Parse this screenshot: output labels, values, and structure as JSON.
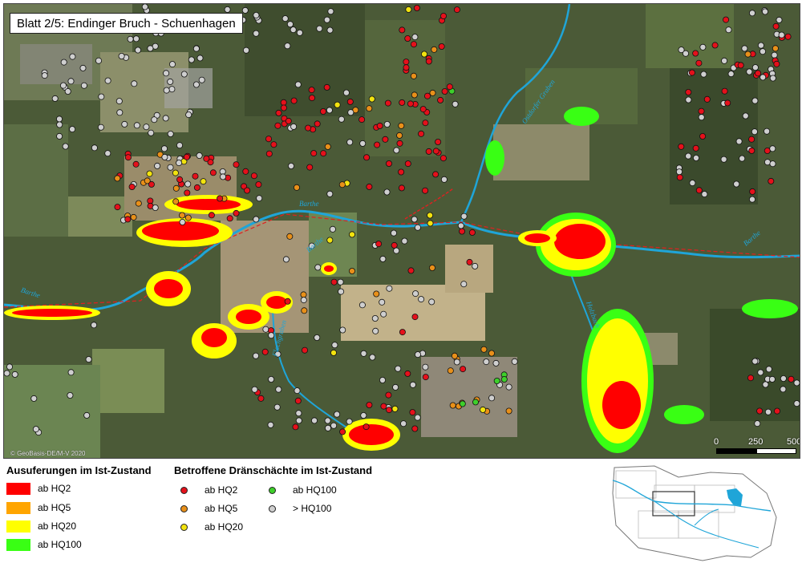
{
  "map": {
    "title": "Blatt 2/5: Endinger Bruch - Schuenhagen",
    "copyright": "© GeoBasis-DE/M-V 2020",
    "scale": {
      "labels": [
        "0",
        "250",
        "500"
      ],
      "unit": "m"
    },
    "water_labels": [
      "Barthe",
      "Barthe",
      "Barthe",
      "Barthe",
      "Ostdorfer Graben",
      "Holzbach",
      "Flachgraben"
    ]
  },
  "legend": {
    "flood_heading": "Ausuferungen im Ist-Zustand",
    "flood_items": [
      {
        "label": "ab HQ2",
        "color": "#ff0000"
      },
      {
        "label": "ab HQ5",
        "color": "#ffa500"
      },
      {
        "label": "ab HQ20",
        "color": "#ffff00"
      },
      {
        "label": "ab HQ100",
        "color": "#39ff14"
      }
    ],
    "shaft_heading": "Betroffene Dränschächte im Ist-Zustand",
    "shaft_items": [
      {
        "label": "ab HQ2",
        "color": "#e4111b"
      },
      {
        "label": "ab HQ5",
        "color": "#e8901a"
      },
      {
        "label": "ab HQ20",
        "color": "#f2e30f"
      },
      {
        "label": "ab HQ100",
        "color": "#3ecf2b"
      },
      {
        "label": "> HQ100",
        "color": "#cfcfcf"
      }
    ]
  },
  "colors": {
    "river": "#1fa5d8",
    "flood_hq2": "#ff0000",
    "flood_hq20": "#ffff00",
    "flood_hq100": "#39ff14"
  }
}
